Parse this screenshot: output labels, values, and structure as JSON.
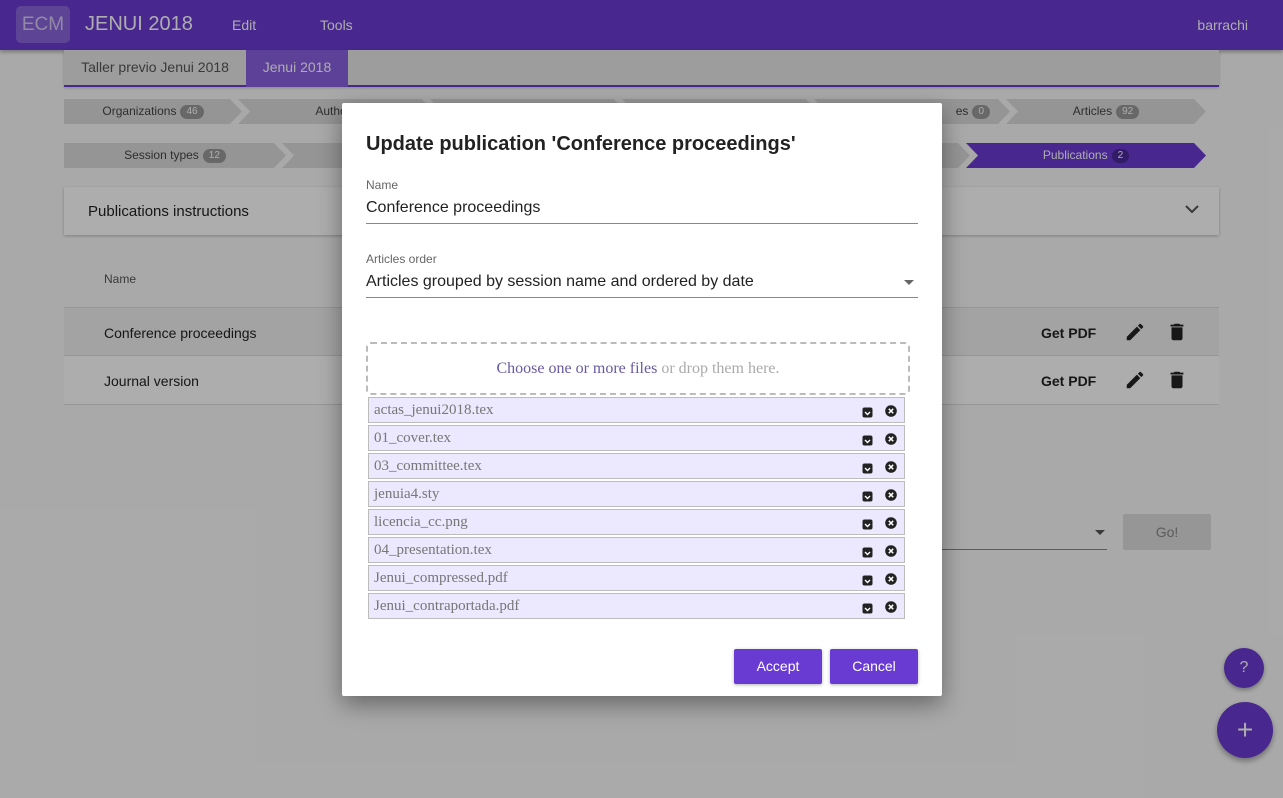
{
  "header": {
    "logo": "ECM",
    "title": "JENUI 2018",
    "menu_edit": "Edit",
    "menu_tools": "Tools",
    "user": "barrachi"
  },
  "conference_tabs": [
    "Taller previo Jenui 2018",
    "Jenui 2018"
  ],
  "breadcrumb_row1": [
    {
      "label": "Organizations",
      "count": "46"
    },
    {
      "label": "Authors",
      "count": ""
    },
    {
      "label": "es",
      "count": "0"
    },
    {
      "label": "Articles",
      "count": "92"
    }
  ],
  "breadcrumb_row2": [
    {
      "label": "Session types",
      "count": "12"
    },
    {
      "label": "Publications",
      "count": "2"
    }
  ],
  "instructions": {
    "label": "Publications instructions"
  },
  "table": {
    "header_name": "Name",
    "rows": [
      {
        "name": "Conference proceedings",
        "action": "Get PDF"
      },
      {
        "name": "Journal version",
        "action": "Get PDF"
      }
    ]
  },
  "go_label": "Go!",
  "fab": {
    "help": "?",
    "add": "+"
  },
  "dialog": {
    "title": "Update publication 'Conference proceedings'",
    "name_label": "Name",
    "name_value": "Conference proceedings",
    "order_label": "Articles order",
    "order_value": "Articles grouped by session name and ordered by date",
    "dropzone_choose": "Choose one or more files",
    "dropzone_drop": " or drop them here.",
    "files": [
      "actas_jenui2018.tex",
      "01_cover.tex",
      "03_committee.tex",
      "jenuia4.sty",
      "licencia_cc.png",
      "04_presentation.tex",
      "Jenui_compressed.pdf",
      "Jenui_contraportada.pdf"
    ],
    "accept": "Accept",
    "cancel": "Cancel"
  },
  "colors": {
    "accent": "#6a3bd2",
    "file_bg": "#ece8fd"
  }
}
